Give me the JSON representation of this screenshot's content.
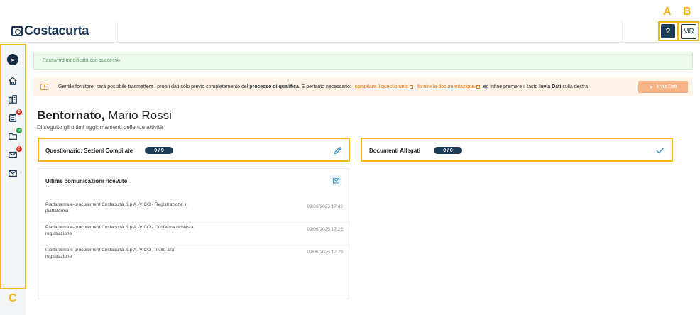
{
  "header": {
    "logo_text": "Costacurta",
    "help_label": "?",
    "user_initials": "MR",
    "callout_a": "A",
    "callout_b": "B"
  },
  "sidebar": {
    "callout_c": "C",
    "items": [
      {
        "icon": "chevron-double-right-icon",
        "label": "»"
      },
      {
        "icon": "home-icon"
      },
      {
        "icon": "buildings-icon"
      },
      {
        "icon": "clipboard-icon",
        "badge": "9"
      },
      {
        "icon": "folder-check-icon",
        "badge": "✓"
      },
      {
        "icon": "mail-alert-icon",
        "badge": "!"
      },
      {
        "icon": "mail-icon"
      }
    ]
  },
  "alerts": {
    "success": "Password modificata con successo",
    "warning_icon": "!",
    "warning_pre": "Gentile fornitore, sarà possibile trasmettere i propri dati solo previo completamento del",
    "warning_bold": "processo di qualifica",
    "warning_mid": ". È pertanto necessario:",
    "link_questionario": "compilare il questionario",
    "link_documentazione": "fornire la documentazione",
    "warning_post_1": "ed infine premere il tasto",
    "warning_bold_2": "Invia Dati",
    "warning_post_2": "sulla destra",
    "send_button": "Invia Dati"
  },
  "welcome": {
    "greeting": "Bentornato,",
    "name": "Mario Rossi",
    "subtitle": "Di seguito gli ultimi aggiornamenti delle tue attività"
  },
  "cards": {
    "questionario_title": "Questionario: Sezioni Compilate",
    "questionario_count": "0 / 9",
    "documenti_title": "Documenti Allegati",
    "documenti_count": "0 / 0"
  },
  "communications": {
    "title": "Ultime comunicazioni ricevute",
    "items": [
      {
        "text": "Piattaforma e-procurement Costacurta S.p.A.-VICO - Registrazione in piattaforma",
        "date": "09/06/2025 17:42"
      },
      {
        "text": "Piattaforma e-procurement Costacurta S.p.A.-VICO - Conferma richiesta registrazione",
        "date": "09/06/2025 17:25"
      },
      {
        "text": "Piattaforma e-procurement Costacurta S.p.A.-VICO - Invito alla registrazione",
        "date": "09/06/2025 17:23"
      }
    ]
  },
  "colors": {
    "navy": "#1b3a55",
    "callout": "#f2b51b",
    "warning_bg": "#fdf3e6",
    "success_bg": "#edf8ef",
    "link_orange": "#e57a1e"
  }
}
